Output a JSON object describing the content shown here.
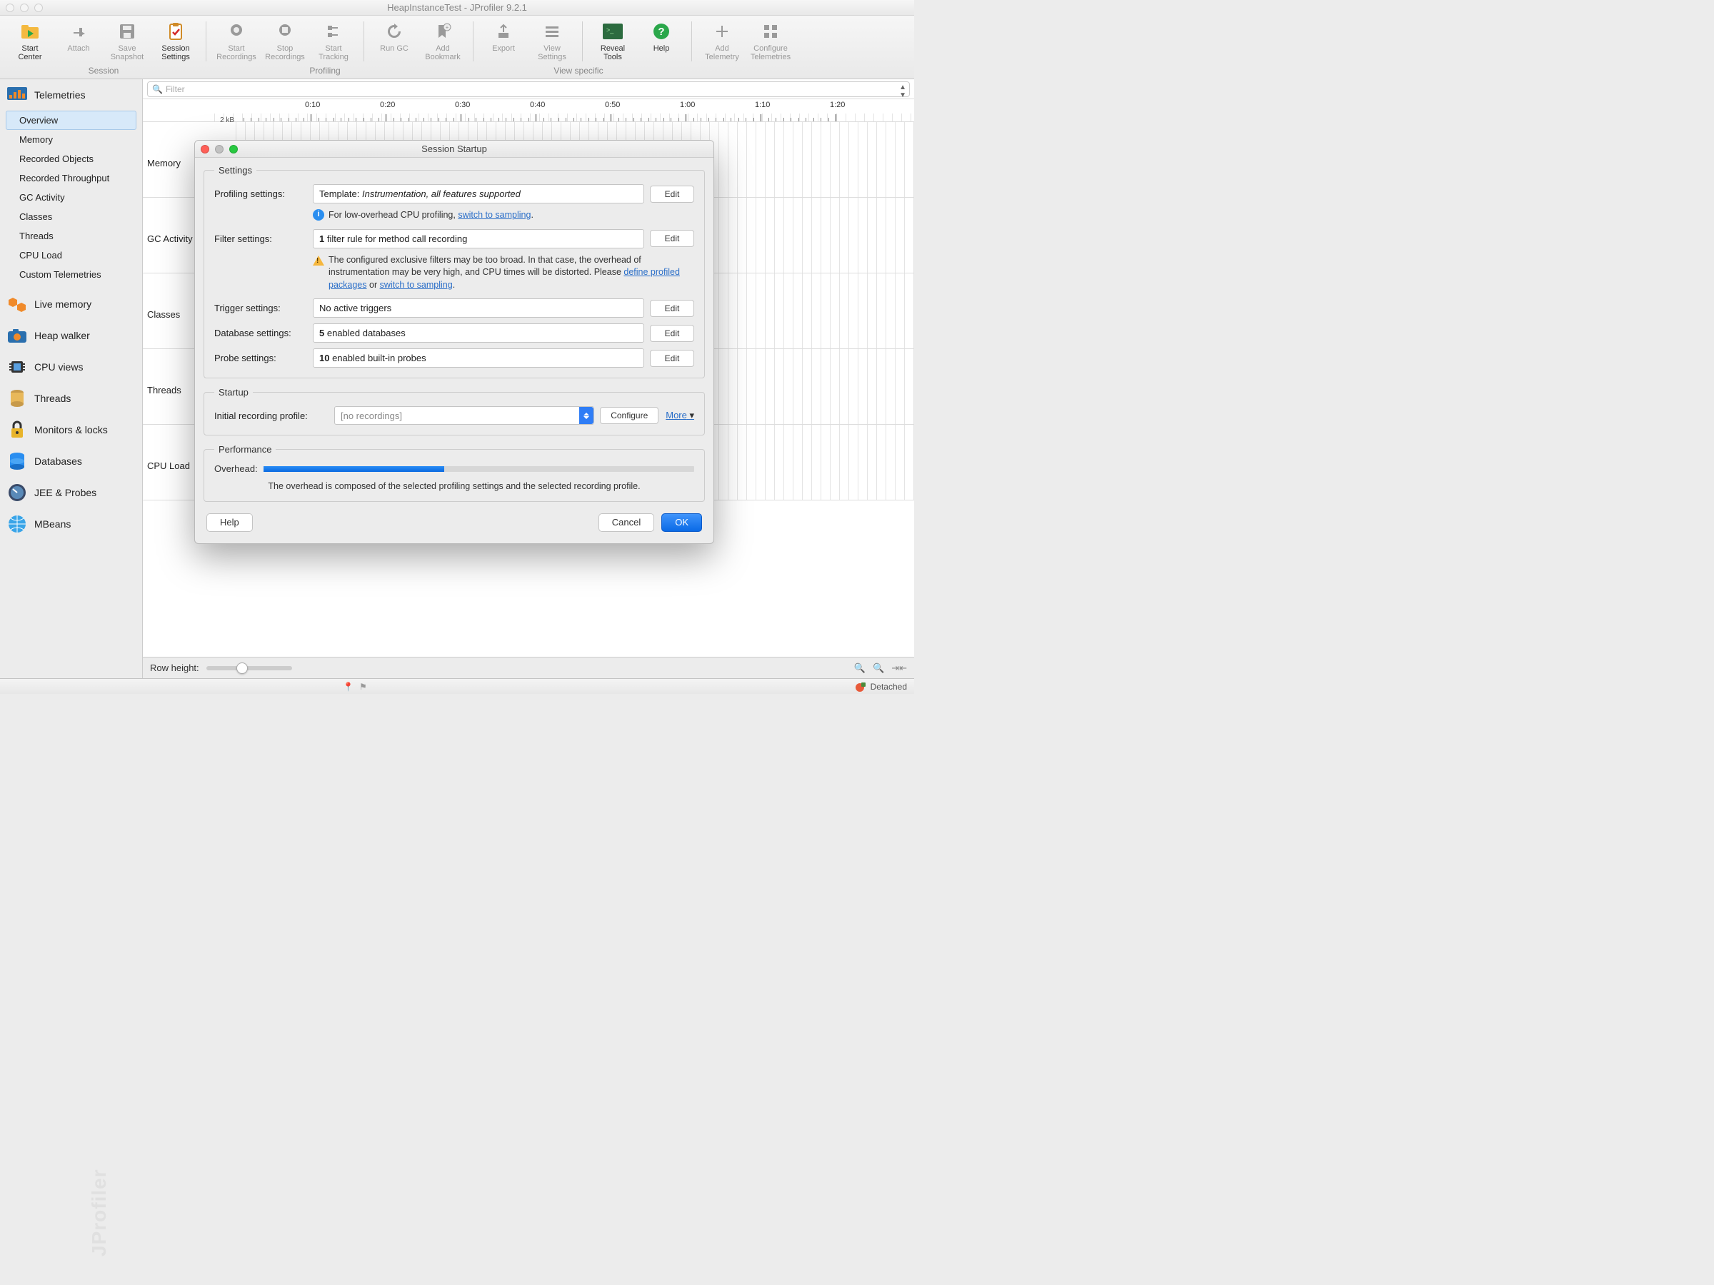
{
  "window": {
    "title": "HeapInstanceTest - JProfiler 9.2.1"
  },
  "toolbar": {
    "groups": {
      "session": "Session",
      "profiling": "Profiling",
      "viewSpecific": "View specific"
    },
    "items": {
      "startCenter": "Start\nCenter",
      "attach": "Attach",
      "saveSnapshot": "Save\nSnapshot",
      "sessionSettings": "Session\nSettings",
      "startRecordings": "Start\nRecordings",
      "stopRecordings": "Stop\nRecordings",
      "startTracking": "Start\nTracking",
      "runGC": "Run GC",
      "addBookmark": "Add\nBookmark",
      "export": "Export",
      "viewSettings": "View\nSettings",
      "revealTools": "Reveal\nTools",
      "help": "Help",
      "addTelemetry": "Add\nTelemetry",
      "configureTelemetries": "Configure\nTelemetries"
    }
  },
  "sidebar": {
    "sections": {
      "telemetries": "Telemetries",
      "liveMemory": "Live memory",
      "heapWalker": "Heap walker",
      "cpuViews": "CPU views",
      "threads": "Threads",
      "monitors": "Monitors & locks",
      "databases": "Databases",
      "jeeProbes": "JEE & Probes",
      "mbeans": "MBeans"
    },
    "telemetryItems": [
      "Overview",
      "Memory",
      "Recorded Objects",
      "Recorded Throughput",
      "GC Activity",
      "Classes",
      "Threads",
      "CPU Load",
      "Custom Telemetries"
    ]
  },
  "filter": {
    "placeholder": "Filter"
  },
  "timeline": {
    "yLabel": "2 kB",
    "ticks": [
      "0:10",
      "0:20",
      "0:30",
      "0:40",
      "0:50",
      "1:00",
      "1:10",
      "1:20"
    ],
    "rows": [
      "Memory",
      "GC Activity",
      "Classes",
      "Threads",
      "CPU Load"
    ]
  },
  "bottom": {
    "rowHeight": "Row height:"
  },
  "status": {
    "detached": "Detached"
  },
  "dialog": {
    "title": "Session Startup",
    "settings": {
      "legend": "Settings",
      "profiling": {
        "label": "Profiling settings:",
        "prefix": "Template: ",
        "value": "Instrumentation, all features supported",
        "edit": "Edit"
      },
      "profilingHint": {
        "text": "For low-overhead CPU profiling, ",
        "link": "switch to sampling",
        "suffix": "."
      },
      "filter": {
        "label": "Filter settings:",
        "bold": "1",
        "rest": " filter rule for method call recording",
        "edit": "Edit"
      },
      "filterWarn": {
        "t1": "The configured exclusive filters may be too broad. In that case, the overhead of instrumentation may be very high, and CPU times will be distorted. Please ",
        "link1": "define profiled packages",
        "t2": " or ",
        "link2": "switch to sampling",
        "t3": "."
      },
      "trigger": {
        "label": "Trigger settings:",
        "value": "No active triggers",
        "edit": "Edit"
      },
      "database": {
        "label": "Database settings:",
        "bold": "5",
        "rest": " enabled databases",
        "edit": "Edit"
      },
      "probe": {
        "label": "Probe settings:",
        "bold": "10",
        "rest": " enabled built-in probes",
        "edit": "Edit"
      }
    },
    "startup": {
      "legend": "Startup",
      "label": "Initial recording profile:",
      "value": "[no recordings]",
      "configure": "Configure",
      "more": "More"
    },
    "performance": {
      "legend": "Performance",
      "label": "Overhead:",
      "desc": "The overhead is composed of the selected profiling settings and the selected recording profile."
    },
    "buttons": {
      "help": "Help",
      "cancel": "Cancel",
      "ok": "OK"
    }
  }
}
